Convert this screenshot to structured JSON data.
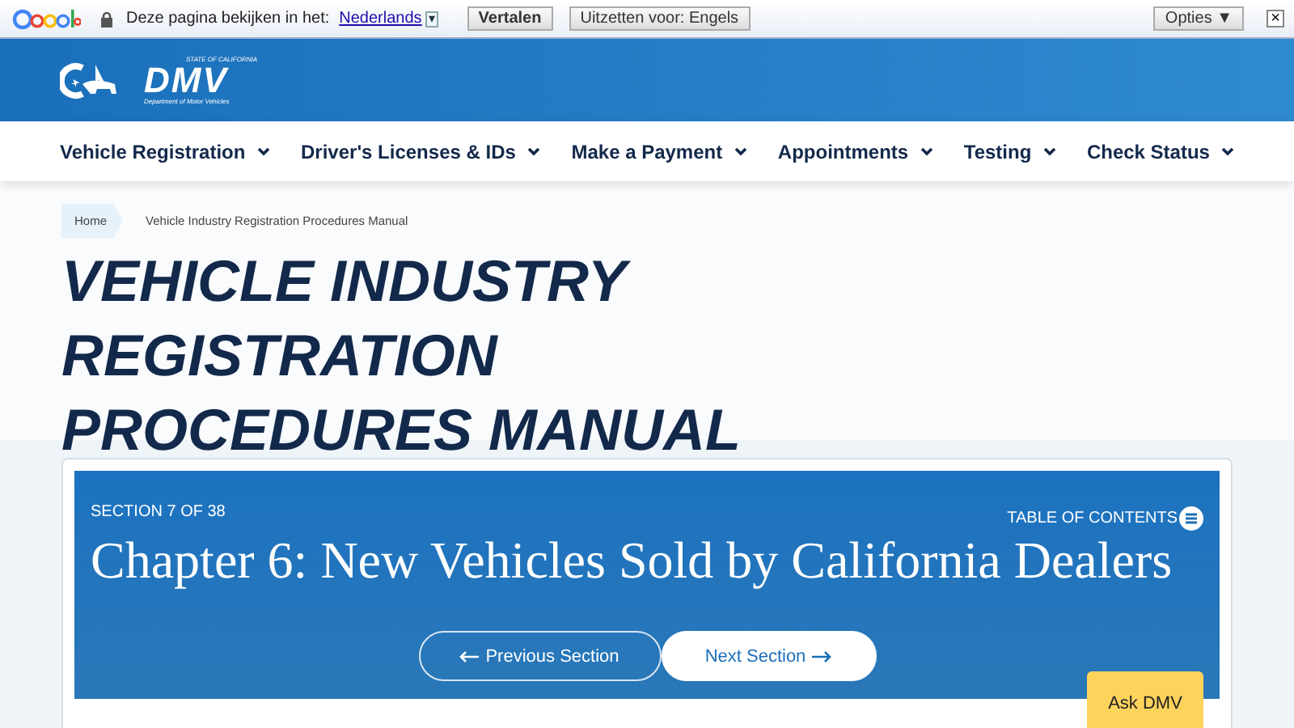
{
  "translate_bar": {
    "prompt": "Deze pagina bekijken in het:",
    "language": "Nederlands",
    "dropdown_glyph": "▾",
    "translate_button": "Vertalen",
    "turn_off_button": "Uitzetten voor: Engels",
    "options_button": "Opties ▼",
    "close_glyph": "×"
  },
  "header": {
    "dmv_logo": {
      "top": "STATE OF CALIFORNIA",
      "main": "DMV",
      "bottom": "Department of Motor Vehicles"
    }
  },
  "nav": [
    {
      "label": "Vehicle Registration"
    },
    {
      "label": "Driver's Licenses & IDs"
    },
    {
      "label": "Make a Payment"
    },
    {
      "label": "Appointments"
    },
    {
      "label": "Testing"
    },
    {
      "label": "Check Status"
    }
  ],
  "breadcrumb": [
    "Home",
    "Vehicle Industry Registration Procedures Manual"
  ],
  "page_title": "VEHICLE INDUSTRY REGISTRATION PROCEDURES MANUAL",
  "section": {
    "counter": "SECTION 7 OF 38",
    "toc": "TABLE OF CONTENTS",
    "title": "Chapter 6: New Vehicles Sold by California Dealers",
    "previous": "Previous Section",
    "next": "Next Section"
  },
  "ask_button": "Ask DMV"
}
